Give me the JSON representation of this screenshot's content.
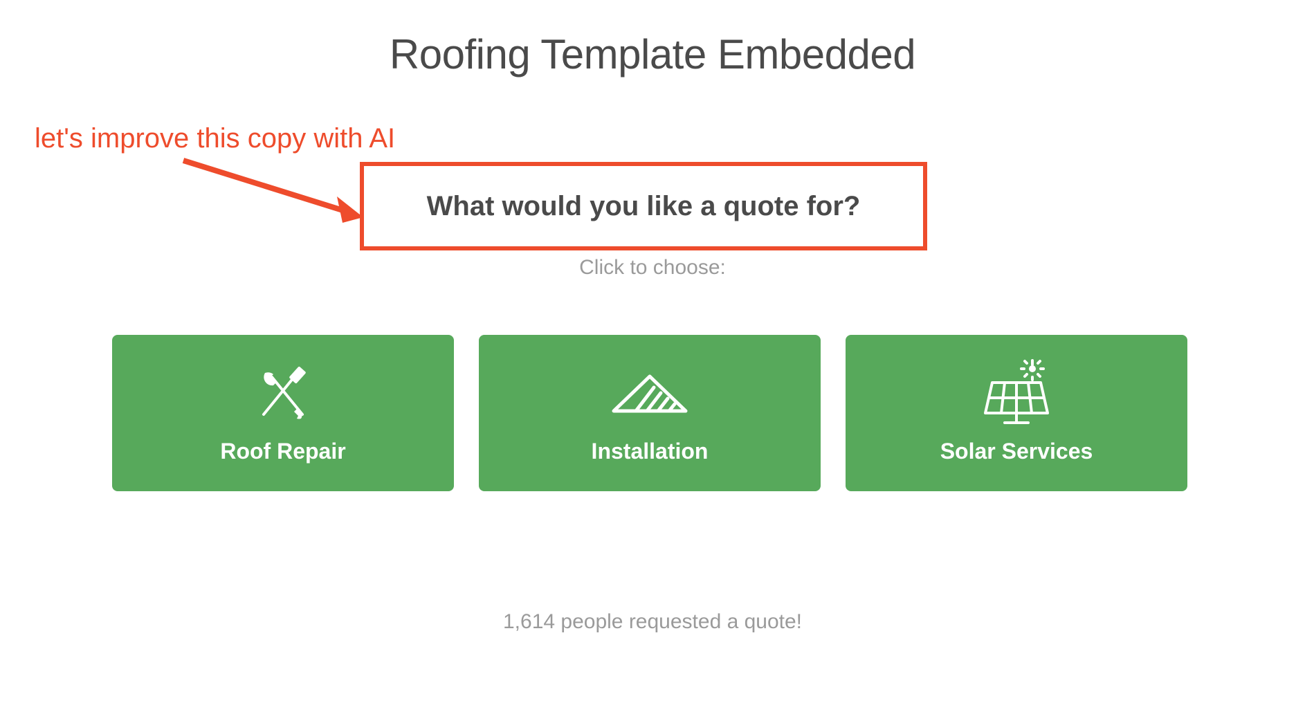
{
  "header": {
    "title": "Roofing Template Embedded"
  },
  "annotation": {
    "text": "let's improve this copy with AI"
  },
  "question": {
    "text": "What would you like a quote for?",
    "subtitle": "Click to choose:"
  },
  "options": [
    {
      "id": "roof-repair",
      "label": "Roof Repair",
      "icon": "tools-icon"
    },
    {
      "id": "installation",
      "label": "Installation",
      "icon": "roof-icon"
    },
    {
      "id": "solar-services",
      "label": "Solar Services",
      "icon": "solar-panel-icon"
    }
  ],
  "stats": {
    "text": "1,614 people requested a quote!"
  },
  "colors": {
    "accent_red": "#ee4c2c",
    "option_green": "#57a95b",
    "text_dark": "#4a4a4a",
    "text_muted": "#9a9a9a"
  }
}
